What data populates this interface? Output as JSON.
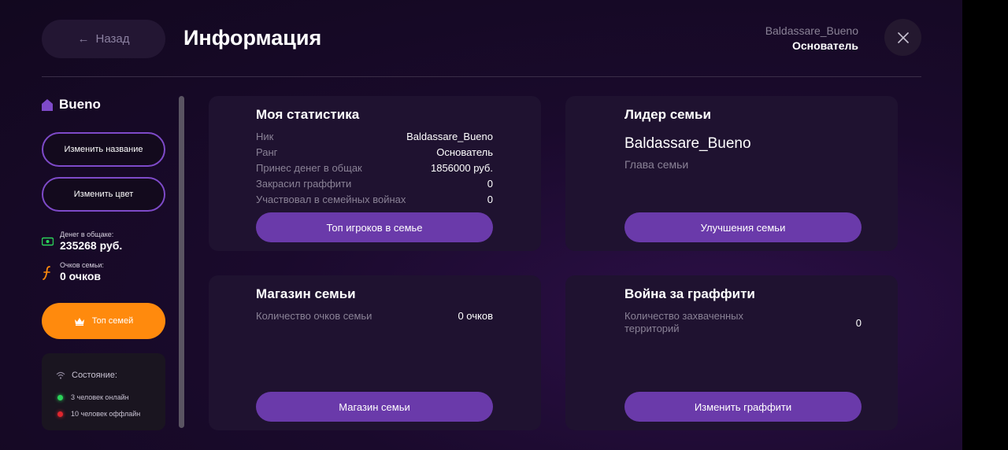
{
  "header": {
    "back_label": "Назад",
    "title": "Информация",
    "user_name": "Baldassare_Bueno",
    "user_role": "Основатель"
  },
  "sidebar": {
    "family_name": "Bueno",
    "rename_label": "Изменить название",
    "recolor_label": "Изменить цвет",
    "money_label": "Денег в общаке:",
    "money_value": "235268 руб.",
    "points_label": "Очков семьи:",
    "points_value": "0 очков",
    "top_families_label": "Топ семей",
    "status_title": "Состояние:",
    "online_text": "3 человек онлайн",
    "offline_text": "10 человек оффлайн"
  },
  "stats_card": {
    "title": "Моя статистика",
    "rows": [
      {
        "label": "Ник",
        "value": "Baldassare_Bueno"
      },
      {
        "label": "Ранг",
        "value": "Основатель"
      },
      {
        "label": "Принес денег в общак",
        "value": "1856000 руб."
      },
      {
        "label": "Закрасил граффити",
        "value": "0"
      },
      {
        "label": "Участвовал в семейных войнах",
        "value": "0"
      }
    ],
    "button_label": "Топ игроков в семье"
  },
  "leader_card": {
    "title": "Лидер семьи",
    "leader_name": "Baldassare_Bueno",
    "leader_role": "Глава семьи",
    "button_label": "Улучшения семьи"
  },
  "shop_card": {
    "title": "Магазин семьи",
    "row_label": "Количество очков семьи",
    "row_value": "0 очков",
    "button_label": "Магазин семьи"
  },
  "war_card": {
    "title": "Война за граффити",
    "row_label": "Количество захваченных территорий",
    "row_value": "0",
    "button_label": "Изменить граффити"
  },
  "colors": {
    "accent_purple": "#6a3aaa",
    "accent_orange": "#ff8a0d",
    "online": "#2bd45a",
    "offline": "#e0262e"
  }
}
